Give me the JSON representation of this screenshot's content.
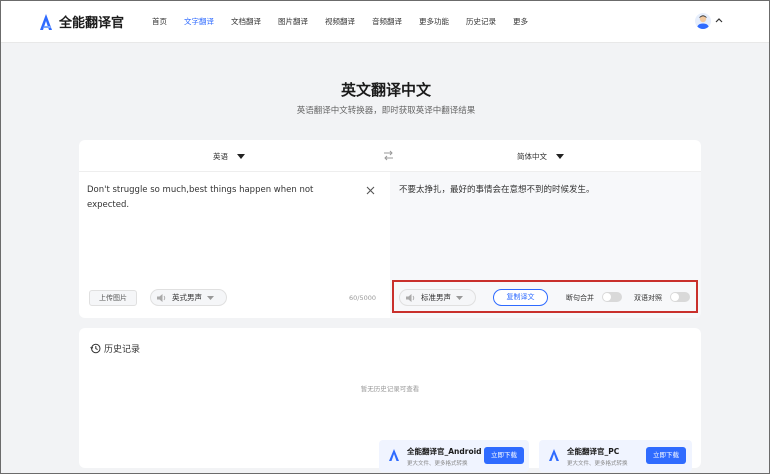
{
  "brand": {
    "name": "全能翻译官",
    "accent": "#2f6bff"
  },
  "nav": [
    {
      "label": "首页",
      "active": false
    },
    {
      "label": "文字翻译",
      "active": true
    },
    {
      "label": "文档翻译",
      "active": false
    },
    {
      "label": "图片翻译",
      "active": false
    },
    {
      "label": "视频翻译",
      "active": false
    },
    {
      "label": "音频翻译",
      "active": false
    },
    {
      "label": "更多功能",
      "active": false
    },
    {
      "label": "历史记录",
      "active": false
    },
    {
      "label": "更多",
      "active": false
    }
  ],
  "hero": {
    "title": "英文翻译中文",
    "subtitle": "英语翻译中文转换器，即时获取英译中翻译结果"
  },
  "translator": {
    "source_lang": "英语",
    "target_lang": "简体中文",
    "source_text": "Don't struggle so much,best things happen when not expected.",
    "target_text": "不要太挣扎，最好的事情会在意想不到的时候发生。",
    "upload_label": "上传图片",
    "source_voice": "英式男声",
    "target_voice": "标准男声",
    "char_count": "60/5000",
    "copy_label": "复制译文",
    "toggle_split": "断句合并",
    "toggle_bilingual": "双语对照",
    "highlight_color": "#c9302c"
  },
  "history": {
    "title": "历史记录",
    "empty": "暂无历史记录可查看"
  },
  "promos": [
    {
      "title": "全能翻译官_Android",
      "subtitle": "更大文件、更多格式转换",
      "button": "立即下载"
    },
    {
      "title": "全能翻译官_PC",
      "subtitle": "更大文件、更多格式转换",
      "button": "立即下载"
    }
  ]
}
